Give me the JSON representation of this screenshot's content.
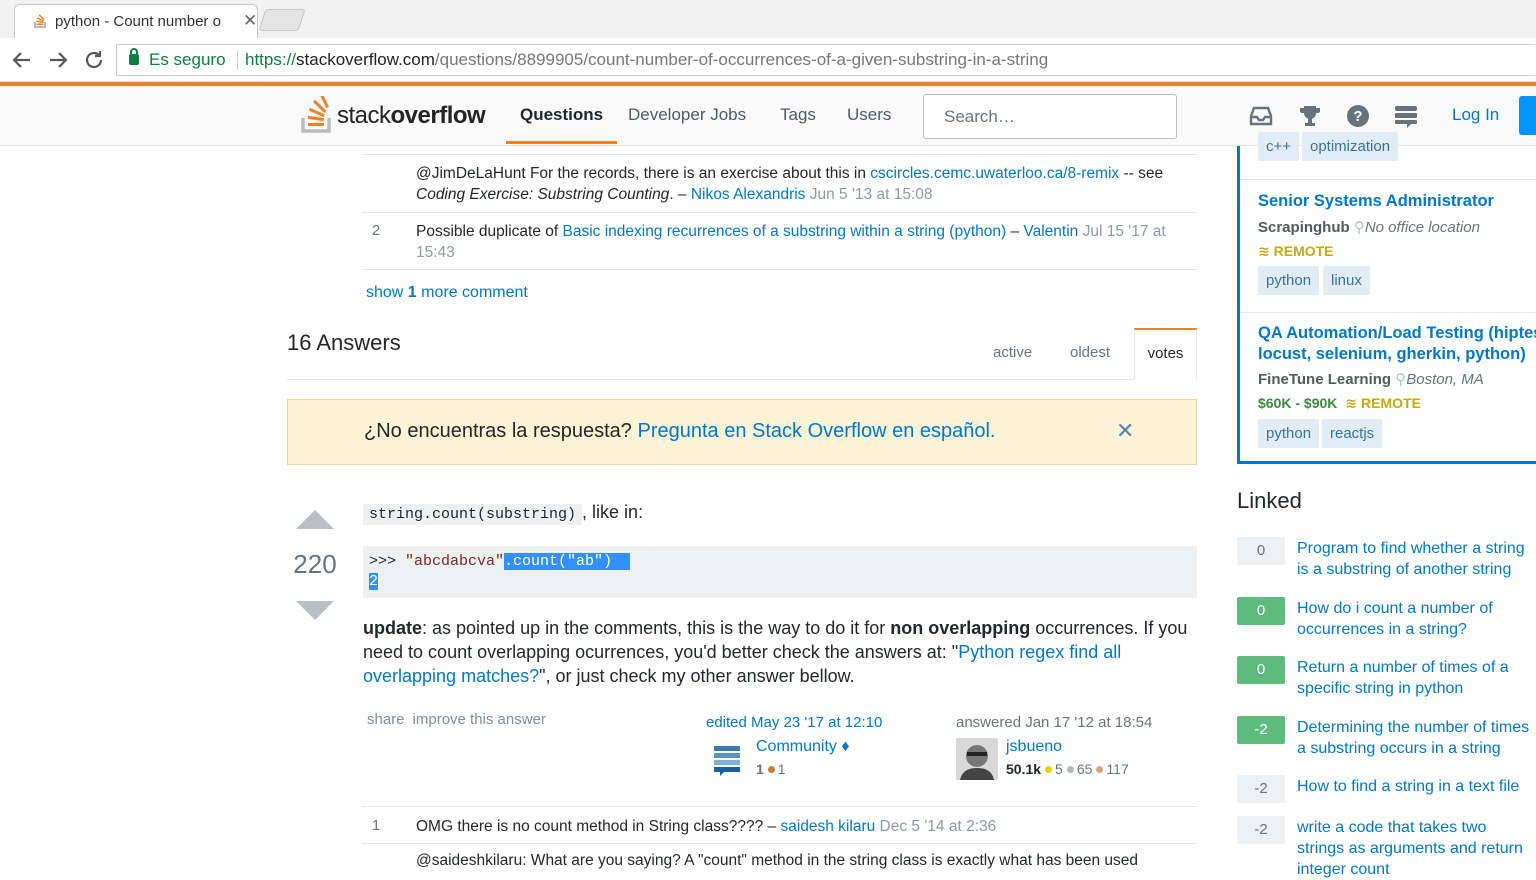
{
  "browser": {
    "tab_title": "python - Count number o",
    "tab_close": "✕",
    "secure_label": "Es seguro",
    "url_scheme": "https://",
    "url_host": "stackoverflow.com",
    "url_path": "/questions/8899905/count-number-of-occurrences-of-a-given-substring-in-a-string"
  },
  "topbar": {
    "logo_plain": "stack",
    "logo_bold": "overflow",
    "nav": [
      "Questions",
      "Developer Jobs",
      "Tags",
      "Users"
    ],
    "search_placeholder": "Search…",
    "login": "Log In",
    "icons": [
      "inbox-icon",
      "trophy-icon",
      "help-icon",
      "stackexchange-icon"
    ]
  },
  "comments": [
    {
      "score": "",
      "text_pre": "@JimDeLaHunt For the records, there is an exercise about this in ",
      "link": "cscircles.cemc.uwaterloo.ca/8-remix",
      "text_mid": " -- see ",
      "emph": "Coding Exercise: Substring Counting",
      "text_post": ". – ",
      "user": "Nikos Alexandris",
      "date": "Jun 5 '13 at 15:08"
    },
    {
      "score": "2",
      "text_pre": "Possible duplicate of ",
      "link": "Basic indexing recurrences of a substring within a string (python)",
      "text_post": " – ",
      "user": "Valentin",
      "date": "Jul 15 '17 at 15:43"
    }
  ],
  "show_more": {
    "pre": "show ",
    "count": "1",
    "post": " more comment"
  },
  "answers": {
    "count_label": "16 Answers",
    "tabs": [
      "active",
      "oldest",
      "votes"
    ]
  },
  "notice": {
    "text": "¿No encuentras la respuesta? ",
    "link": "Pregunta en Stack Overflow en español.",
    "close": "✕"
  },
  "answer": {
    "votes": "220",
    "intro_code": "string.count(substring)",
    "intro_text": ", like in:",
    "code_prompt": ">>> ",
    "code_str": "\"abcdabcva\"",
    "code_selected": ".count(\"ab\")",
    "code_result": "2",
    "update_label": "update",
    "body_1": ": as pointed up in the comments, this is the way to do it for ",
    "body_bold": "non overlapping",
    "body_2": " occurrences. If you need to count overlapping ocurrences, you'd better check the answers at: \"",
    "body_link": "Python regex find all overlapping matches?",
    "body_3": "\", or just check my other answer bellow.",
    "menu": [
      "share",
      "improve this answer"
    ],
    "editor": {
      "action": "edited May 23 '17 at 12:10",
      "name": "Community ♦",
      "rep": "1",
      "badge_bronze": "1"
    },
    "answerer": {
      "action": "answered Jan 17 '12 at 18:54",
      "name": "jsbueno",
      "rep": "50.1k",
      "gold": "5",
      "silver": "65",
      "bronze": "117"
    },
    "first_comment": {
      "score": "1",
      "text": "OMG there is no count method in String class???? – ",
      "user": "saidesh kilaru",
      "date": "Dec 5 '14 at 2:36"
    },
    "cut_comment": "@saideshkilaru: What are you saying? A \"count\" method in the string class is exactly what has been used"
  },
  "jobs": [
    {
      "tags": [
        "c++",
        "optimization"
      ]
    },
    {
      "title": "Senior Systems Administrator",
      "company": "Scrapinghub",
      "location": "No office location",
      "remote": "REMOTE",
      "salary": "",
      "tags": [
        "python",
        "linux"
      ]
    },
    {
      "title_1": "QA Automation/Load Testing (hiptest,",
      "title_2": "locust, selenium, gherkin, python)",
      "company": "FineTune Learning",
      "location": "Boston, MA",
      "remote": "REMOTE",
      "salary": "$60K - $90K",
      "tags": [
        "python",
        "reactjs"
      ]
    }
  ],
  "linked": {
    "title": "Linked",
    "items": [
      {
        "score": "0",
        "answered": false,
        "title": "Program to find whether a string is a substring of another string"
      },
      {
        "score": "0",
        "answered": true,
        "title": "How do i count a number of occurrences in a string?"
      },
      {
        "score": "0",
        "answered": true,
        "title": "Return a number of times of a specific string in python"
      },
      {
        "score": "-2",
        "answered": true,
        "title": "Determining the number of times a substring occurs in a string"
      },
      {
        "score": "-2",
        "answered": false,
        "title": "How to find a string in a text file"
      },
      {
        "score": "-2",
        "answered": false,
        "title": "write a code that takes two strings as arguments and return integer count"
      }
    ]
  },
  "colors": {
    "accent": "#f48024",
    "link": "#0077cc",
    "accepted": "#5eba7d",
    "tag_bg": "#e1ecf4"
  }
}
